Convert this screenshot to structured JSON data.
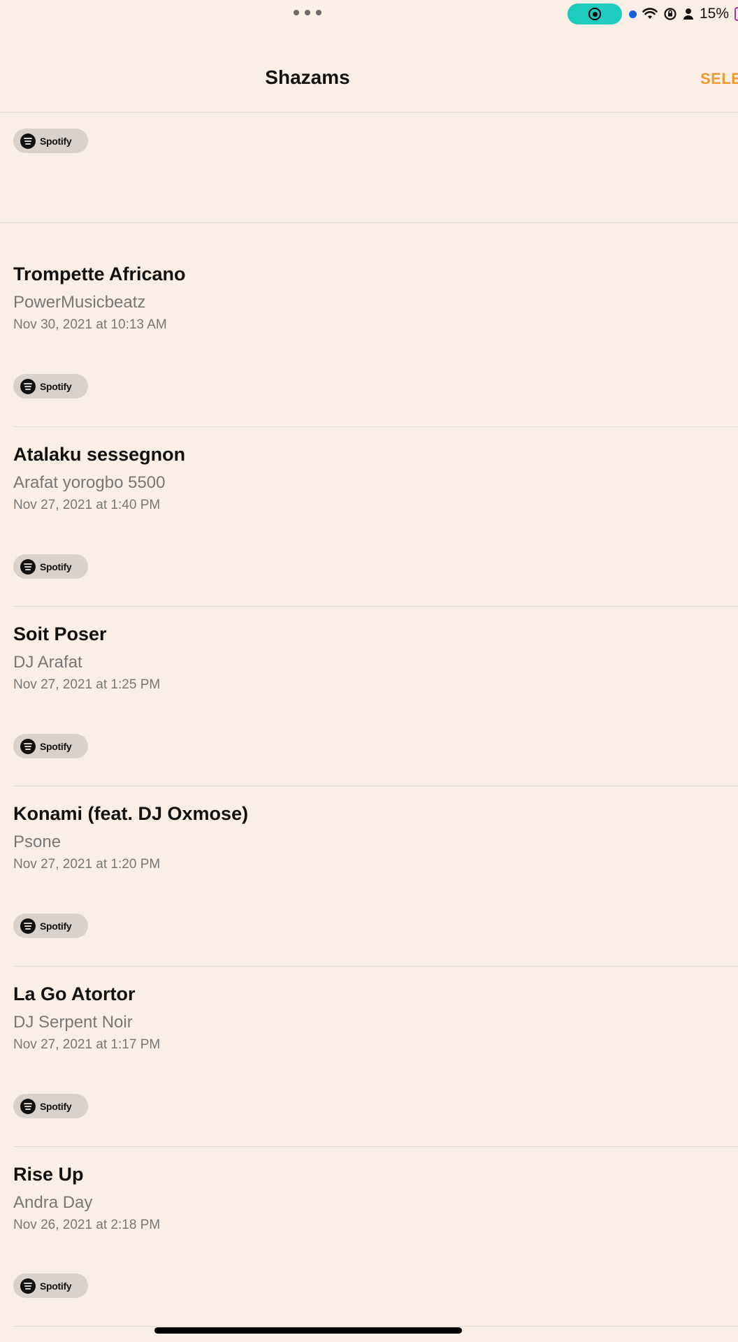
{
  "status_bar": {
    "battery_percent": "15%",
    "icons": [
      "more-dots-icon",
      "screen-record-icon",
      "location-dot-icon",
      "wifi-icon",
      "rotation-lock-icon",
      "person-icon",
      "battery-icon"
    ],
    "accent_record": "#1DCBBF"
  },
  "header": {
    "title": "Shazams",
    "action": "SELE"
  },
  "spotify_label": "Spotify",
  "songs": [
    {
      "title": "Trompette Africano",
      "artist": "PowerMusicbeatz",
      "date": "Nov 30, 2021 at 10:13 AM"
    },
    {
      "title": "Atalaku sessegnon",
      "artist": "Arafat yorogbo 5500",
      "date": "Nov 27, 2021 at 1:40 PM"
    },
    {
      "title": "Soit Poser",
      "artist": "DJ Arafat",
      "date": "Nov 27, 2021 at 1:25 PM"
    },
    {
      "title": "Konami (feat. DJ Oxmose)",
      "artist": "Psone",
      "date": "Nov 27, 2021 at 1:20 PM"
    },
    {
      "title": "La Go Atortor",
      "artist": "DJ Serpent Noir",
      "date": "Nov 27, 2021 at 1:17 PM"
    },
    {
      "title": "Rise Up",
      "artist": "Andra Day",
      "date": "Nov 26, 2021 at 2:18 PM"
    }
  ],
  "colors": {
    "background": "#F9EFE6",
    "accent": "#EE9A2E",
    "secondary_text": "#777777"
  }
}
